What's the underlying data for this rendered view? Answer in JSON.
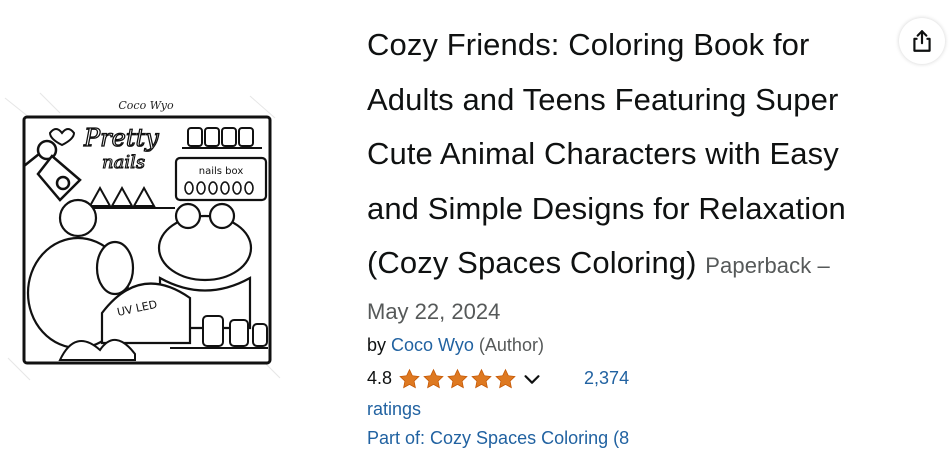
{
  "product": {
    "cover_image_alt": "Cover: Pretty nails coloring page with a frog, nails box, and UV LED lamp",
    "cover_author_text": "Coco Wyo",
    "cover_texts": [
      "Pretty",
      "nails",
      "nails box",
      "UV LED"
    ],
    "title": "Cozy Friends: Coloring Book for Adults and Teens Featuring Super Cute Animal Characters with Easy and Simple Designs for Relaxation (Cozy Spaces Coloring)",
    "format": "Paperback –",
    "release_date": "May 22, 2024",
    "by_label": "by",
    "author": "Coco Wyo",
    "author_role": "(Author)",
    "rating_value": "4.8",
    "rating_stars": 4.8,
    "rating_count": "2,374",
    "ratings_label": "ratings",
    "series": "Part of: Cozy Spaces Coloring (8",
    "share_icon": "share-icon",
    "colors": {
      "star": "#de7921",
      "link": "#2162a1",
      "muted": "#565959",
      "text": "#0f1111"
    }
  }
}
